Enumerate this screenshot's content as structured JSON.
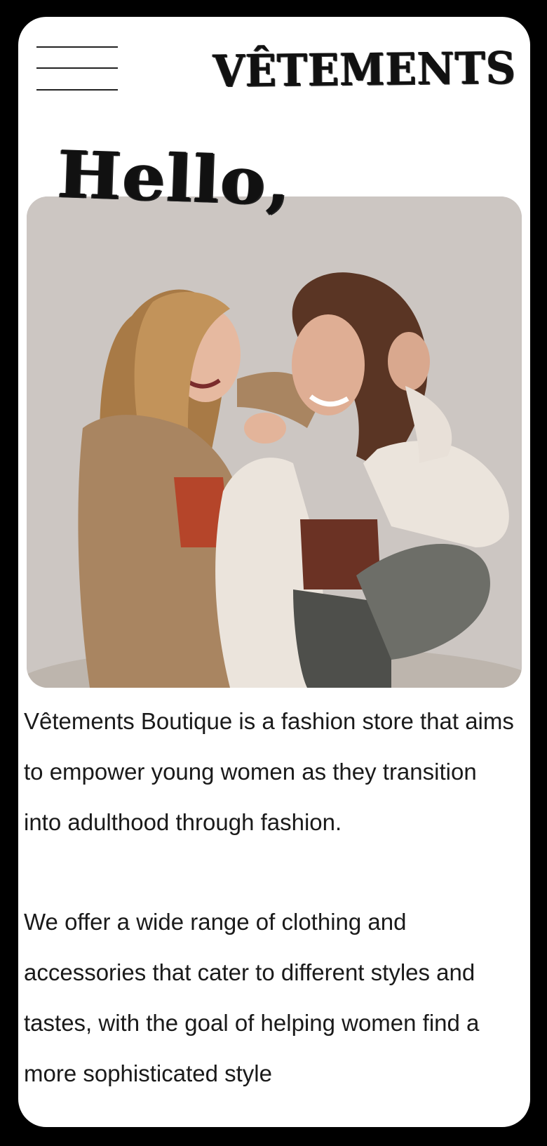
{
  "header": {
    "brand": "VÊTEMENTS",
    "menu_icon": "hamburger-menu-icon"
  },
  "hero": {
    "greeting": "Hello,",
    "image": "photo-two-smiling-women-in-cardigans"
  },
  "intro": {
    "paragraph_1": "Vêtements Boutique is a fashion store that aims to empower young women as they transition into adulthood through fashion.",
    "paragraph_2": "We offer a wide range of clothing and accessories that cater to different styles and tastes, with the goal of helping women find a more sophisticated style"
  },
  "colors": {
    "background": "#ffffff",
    "text": "#1a1a1a",
    "frame": "#000000",
    "photo_backdrop": "#ccc6c2"
  }
}
